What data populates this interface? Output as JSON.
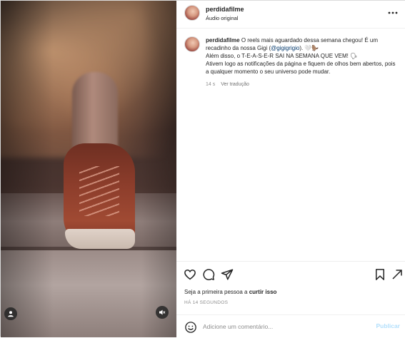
{
  "header": {
    "username": "perdidafilme",
    "audio_label": "Áudio original"
  },
  "caption": {
    "username": "perdidafilme",
    "text_part1": "O reels mais aguardado dessa semana chegou! É um recadinho da nossa Gigi (",
    "mention": "@gigigrigio",
    "text_part2": "). 🤍🦫",
    "line2": "Além disso, o T-E-A-S-E-R SAI NA SEMANA QUE VEM! 🗣",
    "line3": "Ativem logo as notificações da página e fiquem de olhos bem abertos, pois a qualquer momento o seu universo pode mudar.",
    "time": "14 s",
    "translate_label": "Ver tradução"
  },
  "actions": {
    "likes_prefix": "Seja a primeira pessoa a ",
    "likes_bold": "curtir isso",
    "time_ago": "HÁ 14 SEGUNDOS"
  },
  "comment_box": {
    "placeholder": "Adicione um comentário...",
    "value": "",
    "publish_label": "Publicar"
  },
  "colors": {
    "link": "#00376b",
    "muted": "#8e8e8e",
    "publish_disabled": "#b2dffc",
    "text": "#262626"
  }
}
